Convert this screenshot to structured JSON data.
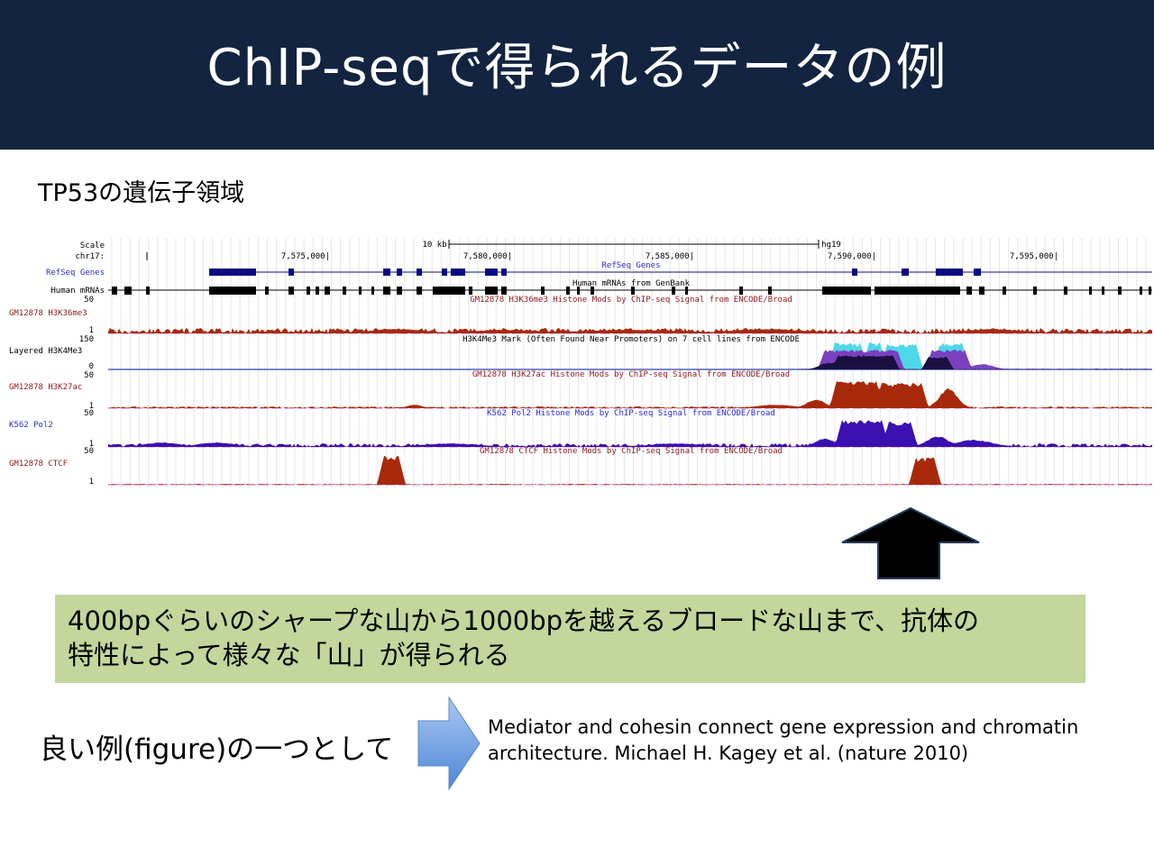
{
  "slide": {
    "title": "ChIP-seqで得られるデータの例",
    "subtitle": "TP53の遺伝子領域",
    "callout_line1": "400bpぐらいのシャープな山から1000bpを越えるブロードな山まで、抗体の",
    "callout_line2": "特性によって様々な「山」が得られる",
    "example_label": "良い例(figure)の一つとして",
    "citation_line1": "Mediator and cohesin connect gene expression and chromatin",
    "citation_line2": "architecture.  Michael H. Kagey et al. (nature 2010)"
  },
  "browser": {
    "scale_label": "Scale",
    "chr_label": "chr17:",
    "scale_bar": "10 kb",
    "assembly": "hg19",
    "positions": [
      "7,575,000|",
      "7,580,000|",
      "7,585,000|",
      "7,590,000|",
      "7,595,000|"
    ],
    "refseq_label": "RefSeq Genes",
    "refseq_title": "RefSeq Genes",
    "mrna_label": "Human mRNAs",
    "mrna_title": "Human mRNAs from GenBank",
    "tracks": [
      {
        "label": "GM12878 H3K36me3",
        "max": "50",
        "min": "1",
        "title": "GM12878 H3K36me3 Histone Mods by ChIP-seq Signal from ENCODE/Broad",
        "color": "#a8290a"
      },
      {
        "label": "Layered H3K4Me3",
        "max": "150",
        "min": "0",
        "title": "H3K4Me3 Mark (Often Found Near Promoters) on 7 cell lines from ENCODE",
        "color": "#1a1040"
      },
      {
        "label": "GM12878 H3K27ac",
        "max": "50",
        "min": "1",
        "title": "GM12878 H3K27ac Histone Mods by ChIP-seq Signal from ENCODE/Broad",
        "color": "#a8290a"
      },
      {
        "label": "K562 Pol2",
        "max": "50",
        "min": "1",
        "title": "K562 Pol2 Histone Mods by ChIP-seq Signal from ENCODE/Broad",
        "color": "#3a10b0"
      },
      {
        "label": "GM12878 CTCF",
        "max": "50",
        "min": "1",
        "title": "GM12878 CTCF Histone Mods by ChIP-seq Signal from ENCODE/Broad",
        "color": "#a8290a"
      }
    ]
  },
  "colors": {
    "header_bg": "#12243f",
    "callout_bg": "#c3d69b",
    "gene_blue": "#0b0b80",
    "label_red": "#8b1a1a",
    "label_blue": "#2b2bd0"
  },
  "icons": [
    "arrow-up-icon",
    "arrow-right-icon"
  ]
}
